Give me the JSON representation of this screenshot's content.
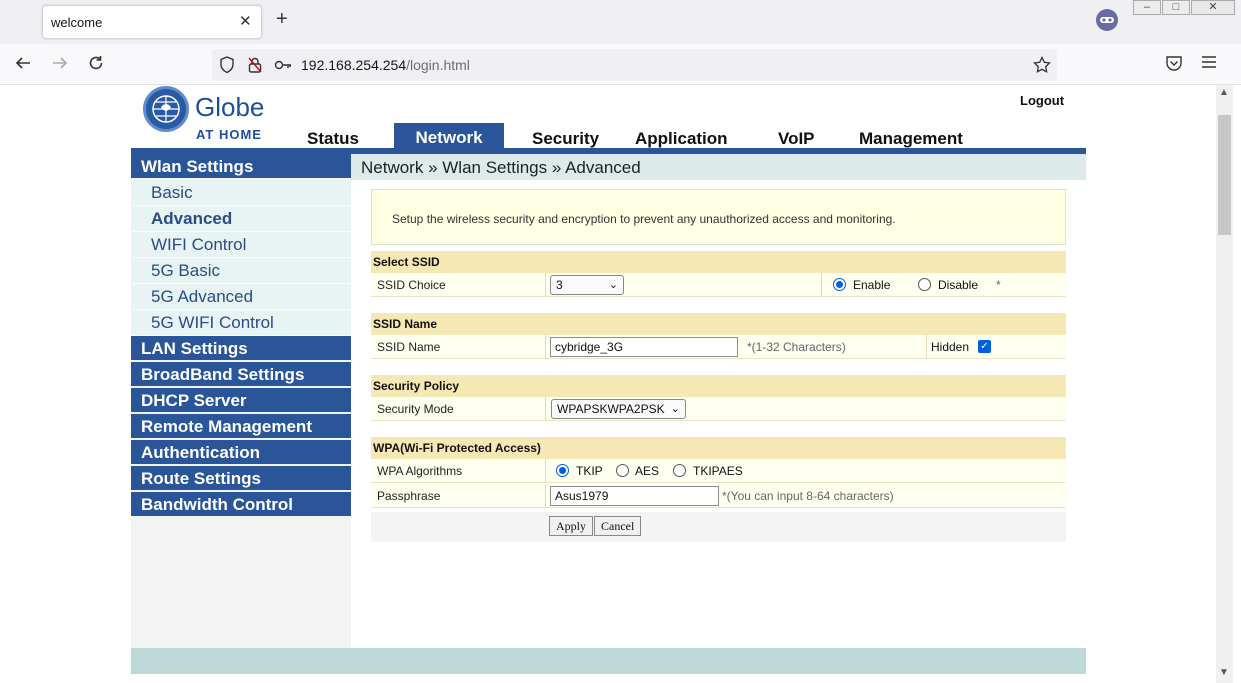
{
  "browser": {
    "tab_title": "welcome",
    "tab_close": "✕",
    "new_tab": "+",
    "url_host": "192.168.254.254",
    "url_path": "/login.html",
    "icons": [
      "back-icon",
      "forward-icon",
      "reload-icon",
      "shield-icon",
      "lock-icon",
      "key-icon",
      "star-icon",
      "pocket-icon",
      "menu-icon",
      "extension-icon"
    ]
  },
  "header": {
    "logo_name": "Globe",
    "logo_sub": "AT HOME",
    "logout": "Logout",
    "brand_color": "#2a5599"
  },
  "topnav": [
    "Status",
    "Network",
    "Security",
    "Application",
    "VoIP",
    "Management"
  ],
  "topnav_active": "Network",
  "breadcrumb": "Network » Wlan Settings » Advanced",
  "sidebar": {
    "sections": [
      {
        "label": "Wlan Settings",
        "items": [
          "Basic",
          "Advanced",
          "WIFI Control",
          "5G Basic",
          "5G Advanced",
          "5G WIFI Control"
        ]
      },
      {
        "label": "LAN Settings"
      },
      {
        "label": "BroadBand Settings"
      },
      {
        "label": "DHCP Server"
      },
      {
        "label": "Remote Management"
      },
      {
        "label": "Authentication"
      },
      {
        "label": "Route Settings"
      },
      {
        "label": "Bandwidth Control"
      }
    ],
    "active_item": "Advanced"
  },
  "main": {
    "info": "Setup the wireless security and encryption to prevent any unauthorized access and monitoring.",
    "select_ssid": {
      "header": "Select SSID",
      "label": "SSID Choice",
      "value": "3",
      "enable_label": "Enable",
      "disable_label": "Disable",
      "asterisk": "*",
      "enabled": true
    },
    "ssid_name": {
      "header": "SSID Name",
      "label": "SSID Name",
      "value": "cybridge_3G",
      "hint": "*(1-32 Characters)",
      "hidden_label": "Hidden",
      "hidden_checked": true
    },
    "security_policy": {
      "header": "Security Policy",
      "label": "Security Mode",
      "value": "WPAPSKWPA2PSK"
    },
    "wpa": {
      "header": "WPA(Wi-Fi Protected Access)",
      "alg_label": "WPA Algorithms",
      "algorithms": [
        "TKIP",
        "AES",
        "TKIPAES"
      ],
      "selected_algorithm": "TKIP",
      "pass_label": "Passphrase",
      "pass_value": "Asus1979",
      "pass_hint": "*(You can input 8-64 characters)"
    },
    "apply_label": "Apply",
    "cancel_label": "Cancel"
  }
}
